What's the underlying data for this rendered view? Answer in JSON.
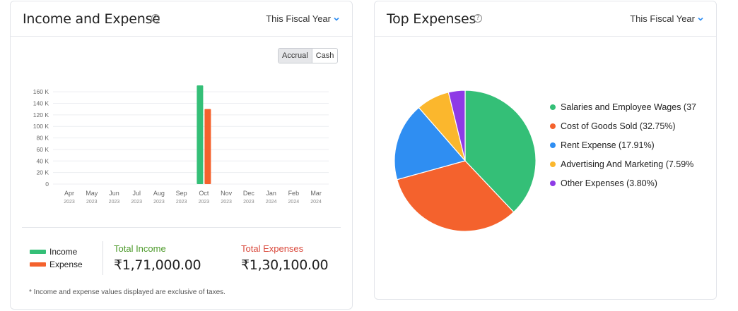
{
  "income_expense": {
    "title": "Income and Expense",
    "help_icon": "question-circle-icon",
    "period_label": "This Fiscal Year",
    "toggle": {
      "accrual": "Accrual",
      "cash": "Cash",
      "selected": "Accrual"
    },
    "legend": {
      "income": "Income",
      "expense": "Expense"
    },
    "total_income_label": "Total Income",
    "total_income_value": "₹1,71,000.00",
    "total_expenses_label": "Total Expenses",
    "total_expenses_value": "₹1,30,100.00",
    "footnote": "* Income and expense values displayed are exclusive of taxes.",
    "colors": {
      "income": "#34bf77",
      "expense": "#f4622d",
      "income_label": "#4c9a2a",
      "expense_label": "#d9483b"
    }
  },
  "top_expenses": {
    "title": "Top Expenses",
    "help_icon": "question-circle-icon",
    "period_label": "This Fiscal Year"
  },
  "chart_data": [
    {
      "type": "bar",
      "categories": [
        "Apr 2023",
        "May 2023",
        "Jun 2023",
        "Jul 2023",
        "Aug 2023",
        "Sep 2023",
        "Oct 2023",
        "Nov 2023",
        "Dec 2023",
        "Jan 2024",
        "Feb 2024",
        "Mar 2024"
      ],
      "category_month": [
        "Apr",
        "May",
        "Jun",
        "Jul",
        "Aug",
        "Sep",
        "Oct",
        "Nov",
        "Dec",
        "Jan",
        "Feb",
        "Mar"
      ],
      "category_year": [
        "2023",
        "2023",
        "2023",
        "2023",
        "2023",
        "2023",
        "2023",
        "2023",
        "2023",
        "2024",
        "2024",
        "2024"
      ],
      "series": [
        {
          "name": "Income",
          "color": "#34bf77",
          "values": [
            0,
            0,
            0,
            0,
            0,
            0,
            171000,
            0,
            0,
            0,
            0,
            0
          ]
        },
        {
          "name": "Expense",
          "color": "#f4622d",
          "values": [
            0,
            0,
            0,
            0,
            0,
            0,
            130100,
            0,
            0,
            0,
            0,
            0
          ]
        }
      ],
      "yticks": [
        "0",
        "20 K",
        "40 K",
        "60 K",
        "80 K",
        "100 K",
        "120 K",
        "140 K",
        "160 K"
      ],
      "ylim": [
        0,
        170000
      ],
      "grid": true
    },
    {
      "type": "pie",
      "labels": [
        "Salaries and Employee Wages (37",
        "Cost of Goods Sold (32.75%)",
        "Rent Expense (17.91%)",
        "Advertising And Marketing (7.59%",
        "Other Expenses (3.80%)"
      ],
      "values": [
        37.95,
        32.75,
        17.91,
        7.59,
        3.8
      ],
      "colors": [
        "#34bf77",
        "#f4622d",
        "#2f8ef2",
        "#fbb72d",
        "#8e3be6"
      ],
      "legend_position": "right"
    }
  ]
}
